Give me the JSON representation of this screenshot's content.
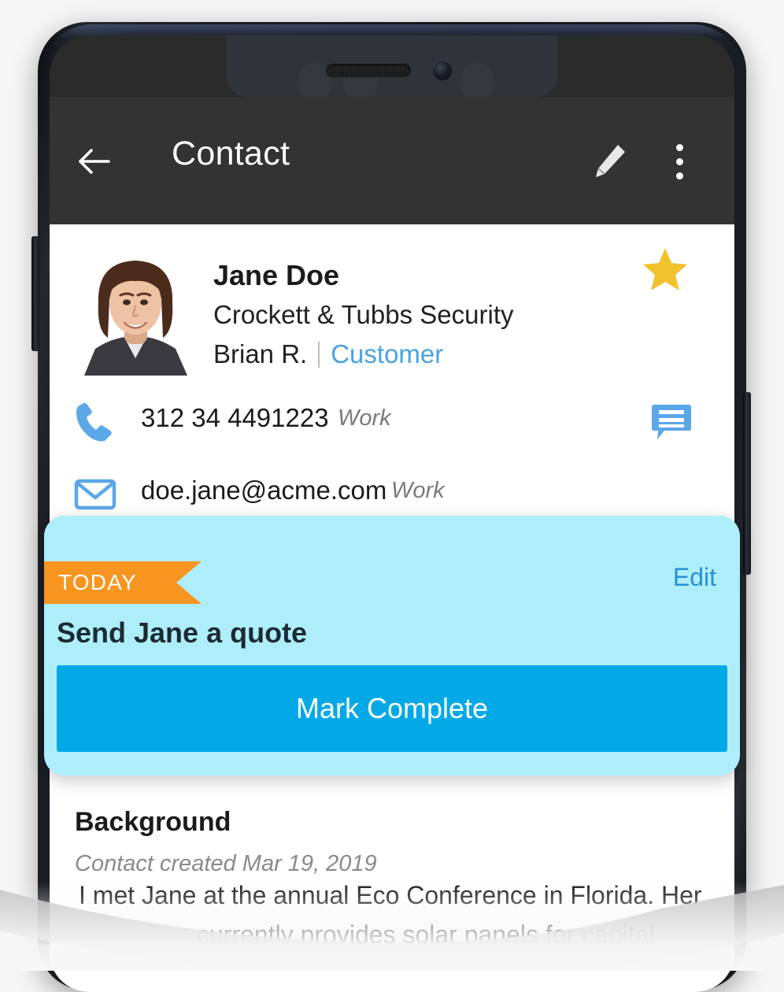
{
  "app_bar": {
    "title": "Contact",
    "back_icon": "back-arrow-icon",
    "edit_icon": "pencil-icon",
    "overflow_icon": "overflow-menu-icon"
  },
  "contact": {
    "name": "Jane Doe",
    "company": "Crockett & Tubbs Security",
    "owner": "Brian R.",
    "divider": "|",
    "type": "Customer",
    "favorite_icon": "star-icon",
    "avatar_icon": "contact-photo"
  },
  "phone_row": {
    "icon": "phone-handset-icon",
    "number": "312 34 4491223",
    "label": "Work",
    "action_icon": "sms-message-icon"
  },
  "email_row": {
    "icon": "envelope-icon",
    "address": "doe.jane@acme.com",
    "label": "Work"
  },
  "task_card": {
    "ribbon_label": "TODAY",
    "edit_label": "Edit",
    "title": "Send Jane a quote",
    "button_label": "Mark Complete"
  },
  "background": {
    "heading": "Background",
    "created": "Contact created Mar 19, 2019",
    "body_line_1": "I met Jane at the annual Eco Conference in Florida. Her",
    "body_line_2": "currently provides solar panels for capital"
  },
  "colors": {
    "accent_blue": "#03a9e6",
    "link_blue": "#2a8fd8",
    "card_bg": "#aeeefb",
    "ribbon_orange": "#f89520",
    "star_gold": "#f2c12e",
    "app_bar": "#333333",
    "icon_blue": "#5ba7e8"
  }
}
